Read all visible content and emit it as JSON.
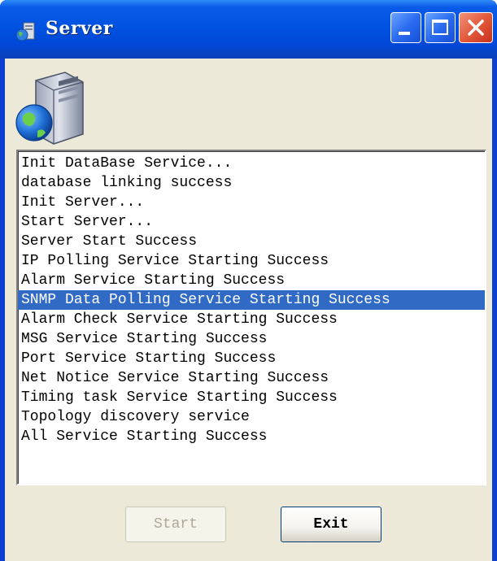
{
  "window": {
    "title": "Server",
    "controls": {
      "minimize_icon": "minimize-icon",
      "maximize_icon": "maximize-icon",
      "close_icon": "close-icon"
    }
  },
  "log": {
    "lines": [
      "Init DataBase Service...",
      "database linking success",
      "Init Server...",
      "Start Server...",
      "Server Start Success",
      "IP Polling Service Starting Success",
      "Alarm Service Starting Success",
      "SNMP Data Polling Service Starting Success",
      "Alarm Check Service Starting Success",
      "MSG Service Starting Success",
      "Port Service Starting Success",
      "Net Notice Service Starting Success",
      "Timing task Service Starting Success",
      "Topology discovery service",
      "All Service Starting Success"
    ],
    "selected_index": 7
  },
  "buttons": {
    "start_label": "Start",
    "start_enabled": false,
    "exit_label": "Exit"
  },
  "colors": {
    "titlebar": "#0054e3",
    "selection": "#316ac5",
    "dialog_bg": "#ece9d8",
    "close_button": "#e25a3c"
  }
}
